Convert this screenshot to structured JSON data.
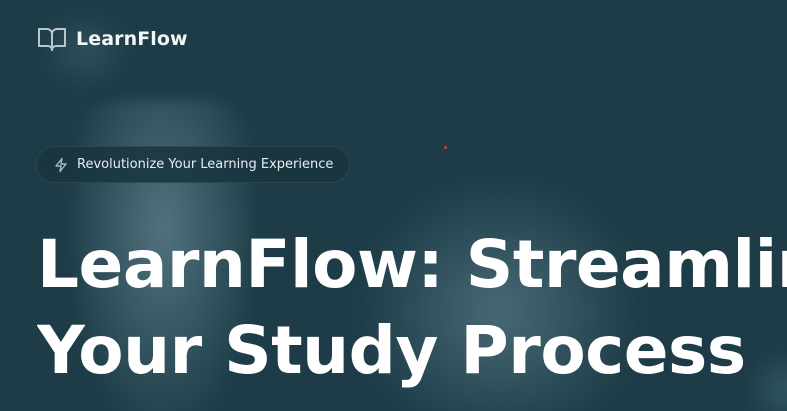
{
  "brand": {
    "name": "LearnFlow",
    "icon": "book-open-icon"
  },
  "badge": {
    "icon": "lightning-icon",
    "text": "Revolutionize Your Learning Experience"
  },
  "hero": {
    "title_line1": "LearnFlow: Streamline",
    "title_line2": "Your Study Process"
  },
  "colors": {
    "background": "#1d3c47",
    "text": "#ffffff",
    "badge_bg": "#19343e"
  }
}
